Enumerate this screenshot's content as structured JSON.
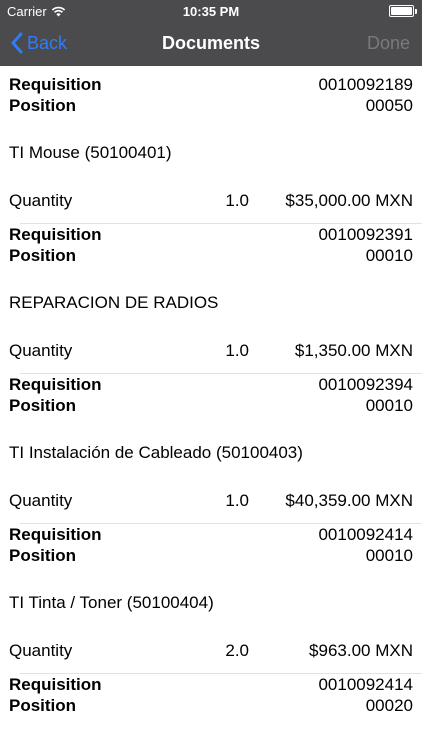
{
  "status_bar": {
    "carrier": "Carrier",
    "time": "10:35 PM"
  },
  "nav": {
    "back_label": "Back",
    "title": "Documents",
    "done_label": "Done"
  },
  "labels": {
    "requisition": "Requisition",
    "position": "Position",
    "quantity": "Quantity"
  },
  "colors": {
    "header_bg": "#4b4b4d",
    "accent": "#2f7cf6",
    "done_disabled": "#7a7a7c"
  },
  "first_req": {
    "requisition": "0010092189",
    "position": "00050"
  },
  "items": [
    {
      "name": "TI Mouse (50100401)",
      "quantity": "1.0",
      "price": "$35,000.00 MXN",
      "requisition": "0010092391",
      "position": "00010"
    },
    {
      "name": "REPARACION DE RADIOS",
      "quantity": "1.0",
      "price": "$1,350.00 MXN",
      "requisition": "0010092394",
      "position": "00010"
    },
    {
      "name": "TI Instalación de Cableado (50100403)",
      "quantity": "1.0",
      "price": "$40,359.00 MXN",
      "requisition": "0010092414",
      "position": "00010"
    },
    {
      "name": "TI Tinta / Toner (50100404)",
      "quantity": "2.0",
      "price": "$963.00 MXN",
      "requisition": "0010092414",
      "position": "00020"
    }
  ]
}
